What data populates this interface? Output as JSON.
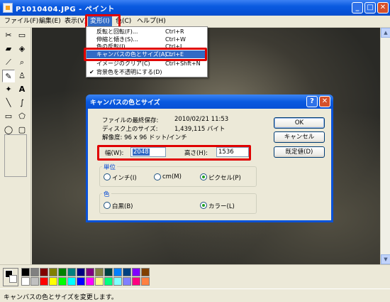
{
  "window": {
    "title": "P1010404.JPG - ペイント",
    "minimize": "_",
    "maximize": "□",
    "close": "✕"
  },
  "menubar": {
    "items": [
      "ファイル(F)",
      "編集(E)",
      "表示(V)",
      "変形(I)",
      "色(C)",
      "ヘルプ(H)"
    ]
  },
  "dropdown": {
    "items": [
      {
        "label": "反転と回転(F)...",
        "shortcut": "Ctrl+R"
      },
      {
        "label": "伸縮と傾き(S)...",
        "shortcut": "Ctrl+W"
      },
      {
        "label": "色の反転(I)",
        "shortcut": "Ctrl+I"
      },
      {
        "label": "キャンバスの色とサイズ(A)...",
        "shortcut": "Ctrl+E"
      },
      {
        "label": "イメージのクリア(C)",
        "shortcut": "Ctrl+Shft+N"
      },
      {
        "label": "背景色を不透明にする(D)",
        "shortcut": "",
        "checked": "✔"
      }
    ]
  },
  "tools": [
    {
      "icon": "free-select-icon",
      "glyph": "⬚"
    },
    {
      "icon": "rect-select-icon",
      "glyph": "▭"
    },
    {
      "icon": "eraser-icon",
      "glyph": "▰"
    },
    {
      "icon": "fill-icon",
      "glyph": "◈"
    },
    {
      "icon": "eyedropper-icon",
      "glyph": "✎"
    },
    {
      "icon": "magnifier-icon",
      "glyph": "🔍"
    },
    {
      "icon": "pencil-icon",
      "glyph": "✏"
    },
    {
      "icon": "brush-icon",
      "glyph": "♙"
    },
    {
      "icon": "airbrush-icon",
      "glyph": "✦"
    },
    {
      "icon": "text-icon",
      "glyph": "A"
    },
    {
      "icon": "line-icon",
      "glyph": "╲"
    },
    {
      "icon": "curve-icon",
      "glyph": "∫"
    },
    {
      "icon": "rectangle-icon",
      "glyph": "▢"
    },
    {
      "icon": "polygon-icon",
      "glyph": "⬠"
    },
    {
      "icon": "ellipse-icon",
      "glyph": "◯"
    },
    {
      "icon": "rounded-rect-icon",
      "glyph": "▢"
    }
  ],
  "palette": {
    "top_row": [
      "#000000",
      "#808080",
      "#800000",
      "#808000",
      "#008000",
      "#008080",
      "#000080",
      "#800080",
      "#808040",
      "#004040",
      "#0080ff",
      "#004080",
      "#8000ff",
      "#804000"
    ],
    "bottom_row": [
      "#ffffff",
      "#c0c0c0",
      "#ff0000",
      "#ffff00",
      "#00ff00",
      "#00ffff",
      "#0000ff",
      "#ff00ff",
      "#ffff80",
      "#00ff80",
      "#80ffff",
      "#8080ff",
      "#ff0080",
      "#ff8040"
    ]
  },
  "dialog": {
    "title": "キャンバスの色とサイズ",
    "help": "?",
    "close": "✕",
    "info": {
      "saved_label": "ファイルの最終保存:",
      "saved_value": "2010/02/21 11:53",
      "disk_label": "ディスク上のサイズ:",
      "disk_value": "1,439,115 バイト",
      "resolution": "解像度: 96 x 96 ドット/インチ"
    },
    "width_label": "幅(W):",
    "width_value": "2048",
    "height_label": "高さ(H):",
    "height_value": "1536",
    "units_group": "単位",
    "units": [
      "インチ(I)",
      "cm(M)",
      "ピクセル(P)"
    ],
    "units_selected": "ピクセル(P)",
    "color_group": "色",
    "colors": [
      "白黒(B)",
      "カラー(L)"
    ],
    "color_selected": "カラー(L)",
    "ok": "OK",
    "cancel": "キャンセル",
    "default": "既定値(D)"
  },
  "status": {
    "text": "キャンバスの色とサイズを変更します。"
  }
}
